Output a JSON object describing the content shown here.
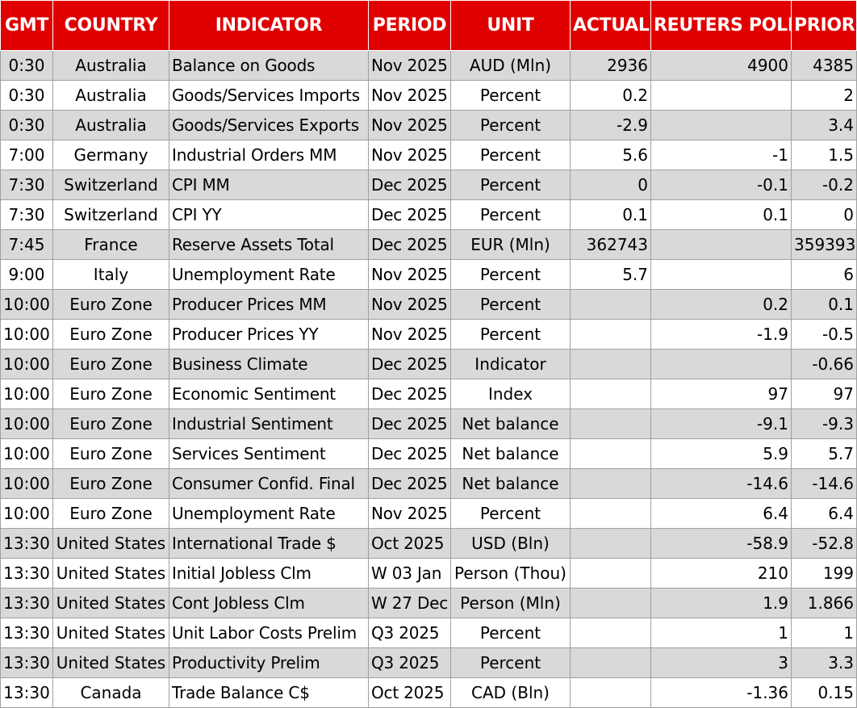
{
  "colors": {
    "header_bg": "#e00000",
    "header_text": "#ffffff",
    "row_alt": "#d9d9d9"
  },
  "headers": {
    "gmt": "GMT",
    "country": "COUNTRY",
    "indicator": "INDICATOR",
    "period": "PERIOD",
    "unit": "UNIT",
    "actual": "ACTUAL",
    "poll": "REUTERS POLL",
    "prior": "PRIOR"
  },
  "rows": [
    {
      "gmt": "0:30",
      "country": "Australia",
      "indicator": "Balance on Goods",
      "period": "Nov 2025",
      "unit": "AUD (Mln)",
      "actual": "2936",
      "poll": "4900",
      "prior": "4385"
    },
    {
      "gmt": "0:30",
      "country": "Australia",
      "indicator": "Goods/Services Imports",
      "period": "Nov 2025",
      "unit": "Percent",
      "actual": "0.2",
      "poll": "",
      "prior": "2"
    },
    {
      "gmt": "0:30",
      "country": "Australia",
      "indicator": "Goods/Services Exports",
      "period": "Nov 2025",
      "unit": "Percent",
      "actual": "-2.9",
      "poll": "",
      "prior": "3.4"
    },
    {
      "gmt": "7:00",
      "country": "Germany",
      "indicator": "Industrial Orders MM",
      "period": "Nov 2025",
      "unit": "Percent",
      "actual": "5.6",
      "poll": "-1",
      "prior": "1.5"
    },
    {
      "gmt": "7:30",
      "country": "Switzerland",
      "indicator": "CPI MM",
      "period": "Dec 2025",
      "unit": "Percent",
      "actual": "0",
      "poll": "-0.1",
      "prior": "-0.2"
    },
    {
      "gmt": "7:30",
      "country": "Switzerland",
      "indicator": "CPI YY",
      "period": "Dec 2025",
      "unit": "Percent",
      "actual": "0.1",
      "poll": "0.1",
      "prior": "0"
    },
    {
      "gmt": "7:45",
      "country": "France",
      "indicator": "Reserve Assets Total",
      "period": "Dec 2025",
      "unit": "EUR (Mln)",
      "actual": "362743",
      "poll": "",
      "prior": "359393"
    },
    {
      "gmt": "9:00",
      "country": "Italy",
      "indicator": "Unemployment Rate",
      "period": "Nov 2025",
      "unit": "Percent",
      "actual": "5.7",
      "poll": "",
      "prior": "6"
    },
    {
      "gmt": "10:00",
      "country": "Euro Zone",
      "indicator": "Producer Prices MM",
      "period": "Nov 2025",
      "unit": "Percent",
      "actual": "",
      "poll": "0.2",
      "prior": "0.1"
    },
    {
      "gmt": "10:00",
      "country": "Euro Zone",
      "indicator": "Producer Prices YY",
      "period": "Nov 2025",
      "unit": "Percent",
      "actual": "",
      "poll": "-1.9",
      "prior": "-0.5"
    },
    {
      "gmt": "10:00",
      "country": "Euro Zone",
      "indicator": "Business Climate",
      "period": "Dec 2025",
      "unit": "Indicator",
      "actual": "",
      "poll": "",
      "prior": "-0.66"
    },
    {
      "gmt": "10:00",
      "country": "Euro Zone",
      "indicator": "Economic Sentiment",
      "period": "Dec 2025",
      "unit": "Index",
      "actual": "",
      "poll": "97",
      "prior": "97"
    },
    {
      "gmt": "10:00",
      "country": "Euro Zone",
      "indicator": "Industrial Sentiment",
      "period": "Dec 2025",
      "unit": "Net balance",
      "actual": "",
      "poll": "-9.1",
      "prior": "-9.3"
    },
    {
      "gmt": "10:00",
      "country": "Euro Zone",
      "indicator": "Services Sentiment",
      "period": "Dec 2025",
      "unit": "Net balance",
      "actual": "",
      "poll": "5.9",
      "prior": "5.7"
    },
    {
      "gmt": "10:00",
      "country": "Euro Zone",
      "indicator": "Consumer Confid. Final",
      "period": "Dec 2025",
      "unit": "Net balance",
      "actual": "",
      "poll": "-14.6",
      "prior": "-14.6"
    },
    {
      "gmt": "10:00",
      "country": "Euro Zone",
      "indicator": "Unemployment Rate",
      "period": "Nov 2025",
      "unit": "Percent",
      "actual": "",
      "poll": "6.4",
      "prior": "6.4"
    },
    {
      "gmt": "13:30",
      "country": "United States",
      "indicator": "International Trade $",
      "period": "Oct 2025",
      "unit": "USD (Bln)",
      "actual": "",
      "poll": "-58.9",
      "prior": "-52.8"
    },
    {
      "gmt": "13:30",
      "country": "United States",
      "indicator": "Initial Jobless Clm",
      "period": "W 03 Jan",
      "unit": "Person (Thou)",
      "actual": "",
      "poll": "210",
      "prior": "199"
    },
    {
      "gmt": "13:30",
      "country": "United States",
      "indicator": "Cont Jobless Clm",
      "period": "W 27 Dec",
      "unit": "Person (Mln)",
      "actual": "",
      "poll": "1.9",
      "prior": "1.866"
    },
    {
      "gmt": "13:30",
      "country": "United States",
      "indicator": "Unit Labor Costs Prelim",
      "period": "Q3 2025",
      "unit": "Percent",
      "actual": "",
      "poll": "1",
      "prior": "1"
    },
    {
      "gmt": "13:30",
      "country": "United States",
      "indicator": "Productivity Prelim",
      "period": "Q3 2025",
      "unit": "Percent",
      "actual": "",
      "poll": "3",
      "prior": "3.3"
    },
    {
      "gmt": "13:30",
      "country": "Canada",
      "indicator": "Trade Balance C$",
      "period": "Oct 2025",
      "unit": "CAD (Bln)",
      "actual": "",
      "poll": "-1.36",
      "prior": "0.15"
    }
  ]
}
